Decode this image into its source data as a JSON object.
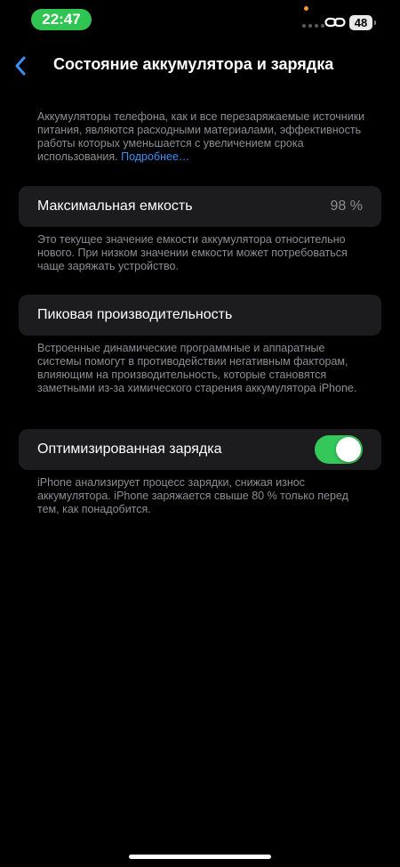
{
  "status_bar": {
    "time": "22:47",
    "battery_level": "48",
    "time_pill_color": "#30c552",
    "icons": [
      "privacy-dot",
      "cellular-signal-icon",
      "personal-hotspot-link-icon",
      "battery-icon"
    ]
  },
  "nav": {
    "back_icon": "chevron-left-icon",
    "title": "Состояние аккумулятора и зарядка",
    "accent_color": "#3d8ff5"
  },
  "intro": {
    "text": "Аккумуляторы телефона, как и все перезаряжаемые источники питания, являются расходными материа­лами, эффективность работы которых уменьшается с увеличением срока использования.",
    "link_label": "Подробнее…"
  },
  "max_capacity": {
    "label": "Максимальная емкость",
    "value": "98 %",
    "footnote": "Это текущее значение емкости аккумулятора относительно нового. При низком значении емкости может потребоваться чаще заряжать устройство."
  },
  "peak_performance": {
    "label": "Пиковая производительность",
    "footnote": "Встроенные динамические программные и аппаратные системы помогут в противодействии негативным факторам, влияющим на производительность, которые становятся заметными из-за химического старения аккумулятора iPhone."
  },
  "optimized_charging": {
    "label": "Оптимизированная зарядка",
    "enabled": true,
    "toggle_color": "#34c759",
    "footnote": "iPhone анализирует процесс зарядки, снижая износ аккумулятора. iPhone заряжается свыше 80 % только перед тем, как понадобится."
  }
}
